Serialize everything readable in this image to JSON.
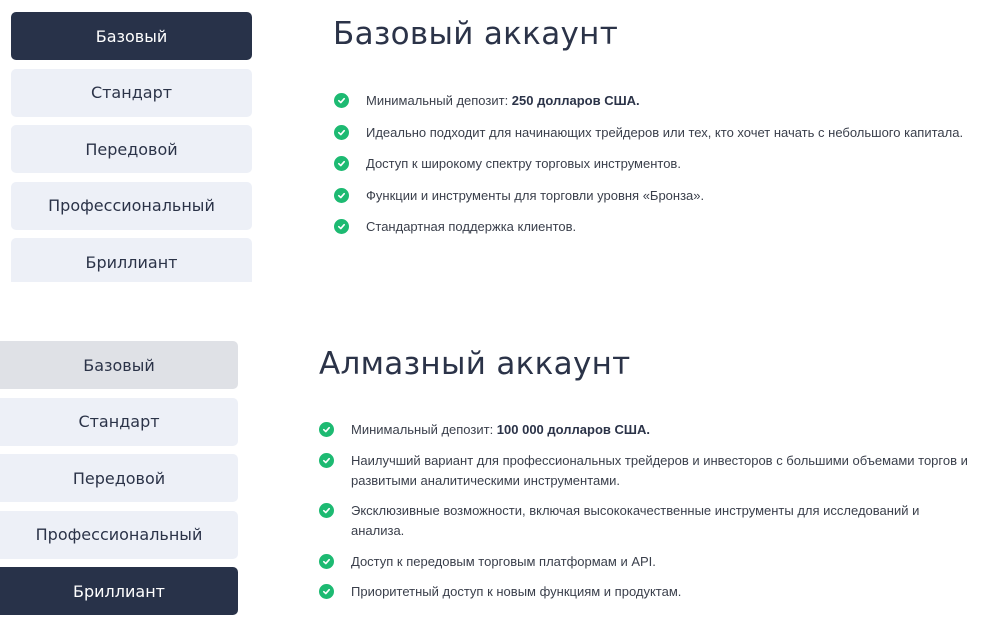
{
  "colors": {
    "active_tab_bg": "#283249",
    "inactive_tab_bg": "#edf0f7",
    "hover_tab_bg": "#dfe1e6",
    "check_green": "#1dba72",
    "heading_text": "#2b3348"
  },
  "panels": [
    {
      "tabs": [
        {
          "label": "Базовый",
          "state": "active"
        },
        {
          "label": "Стандарт",
          "state": "inactive"
        },
        {
          "label": "Передовой",
          "state": "inactive"
        },
        {
          "label": "Профессиональный",
          "state": "inactive"
        },
        {
          "label": "Бриллиант",
          "state": "inactive"
        }
      ],
      "title": "Базовый аккаунт",
      "features": [
        {
          "icon": "check-circle-icon",
          "text": "Минимальный депозит: ",
          "bold": "250 долларов США."
        },
        {
          "icon": "check-circle-icon",
          "text": "Идеально подходит для начинающих трейдеров или тех, кто хочет начать с небольшого капитала.",
          "bold": ""
        },
        {
          "icon": "check-circle-icon",
          "text": "Доступ к широкому спектру торговых инструментов.",
          "bold": ""
        },
        {
          "icon": "check-circle-icon",
          "text": "Функции и инструменты для торговли уровня «Бронза».",
          "bold": ""
        },
        {
          "icon": "check-circle-icon",
          "text": "Стандартная поддержка клиентов.",
          "bold": ""
        }
      ]
    },
    {
      "tabs": [
        {
          "label": "Базовый",
          "state": "hover"
        },
        {
          "label": "Стандарт",
          "state": "inactive"
        },
        {
          "label": "Передовой",
          "state": "inactive"
        },
        {
          "label": "Профессиональный",
          "state": "inactive"
        },
        {
          "label": "Бриллиант",
          "state": "active"
        }
      ],
      "title": "Алмазный аккаунт",
      "features": [
        {
          "icon": "check-circle-icon",
          "text": "Минимальный депозит: ",
          "bold": "100 000 долларов США."
        },
        {
          "icon": "check-circle-icon",
          "text": "Наилучший вариант для профессиональных трейдеров и инвесторов с большими объемами торгов и развитыми аналитическими инструментами.",
          "bold": ""
        },
        {
          "icon": "check-circle-icon",
          "text": "Эксклюзивные возможности, включая высококачественные инструменты для исследований и анализа.",
          "bold": ""
        },
        {
          "icon": "check-circle-icon",
          "text": "Доступ к передовым торговым платформам и API.",
          "bold": ""
        },
        {
          "icon": "check-circle-icon",
          "text": "Приоритетный доступ к новым функциям и продуктам.",
          "bold": ""
        }
      ]
    }
  ]
}
